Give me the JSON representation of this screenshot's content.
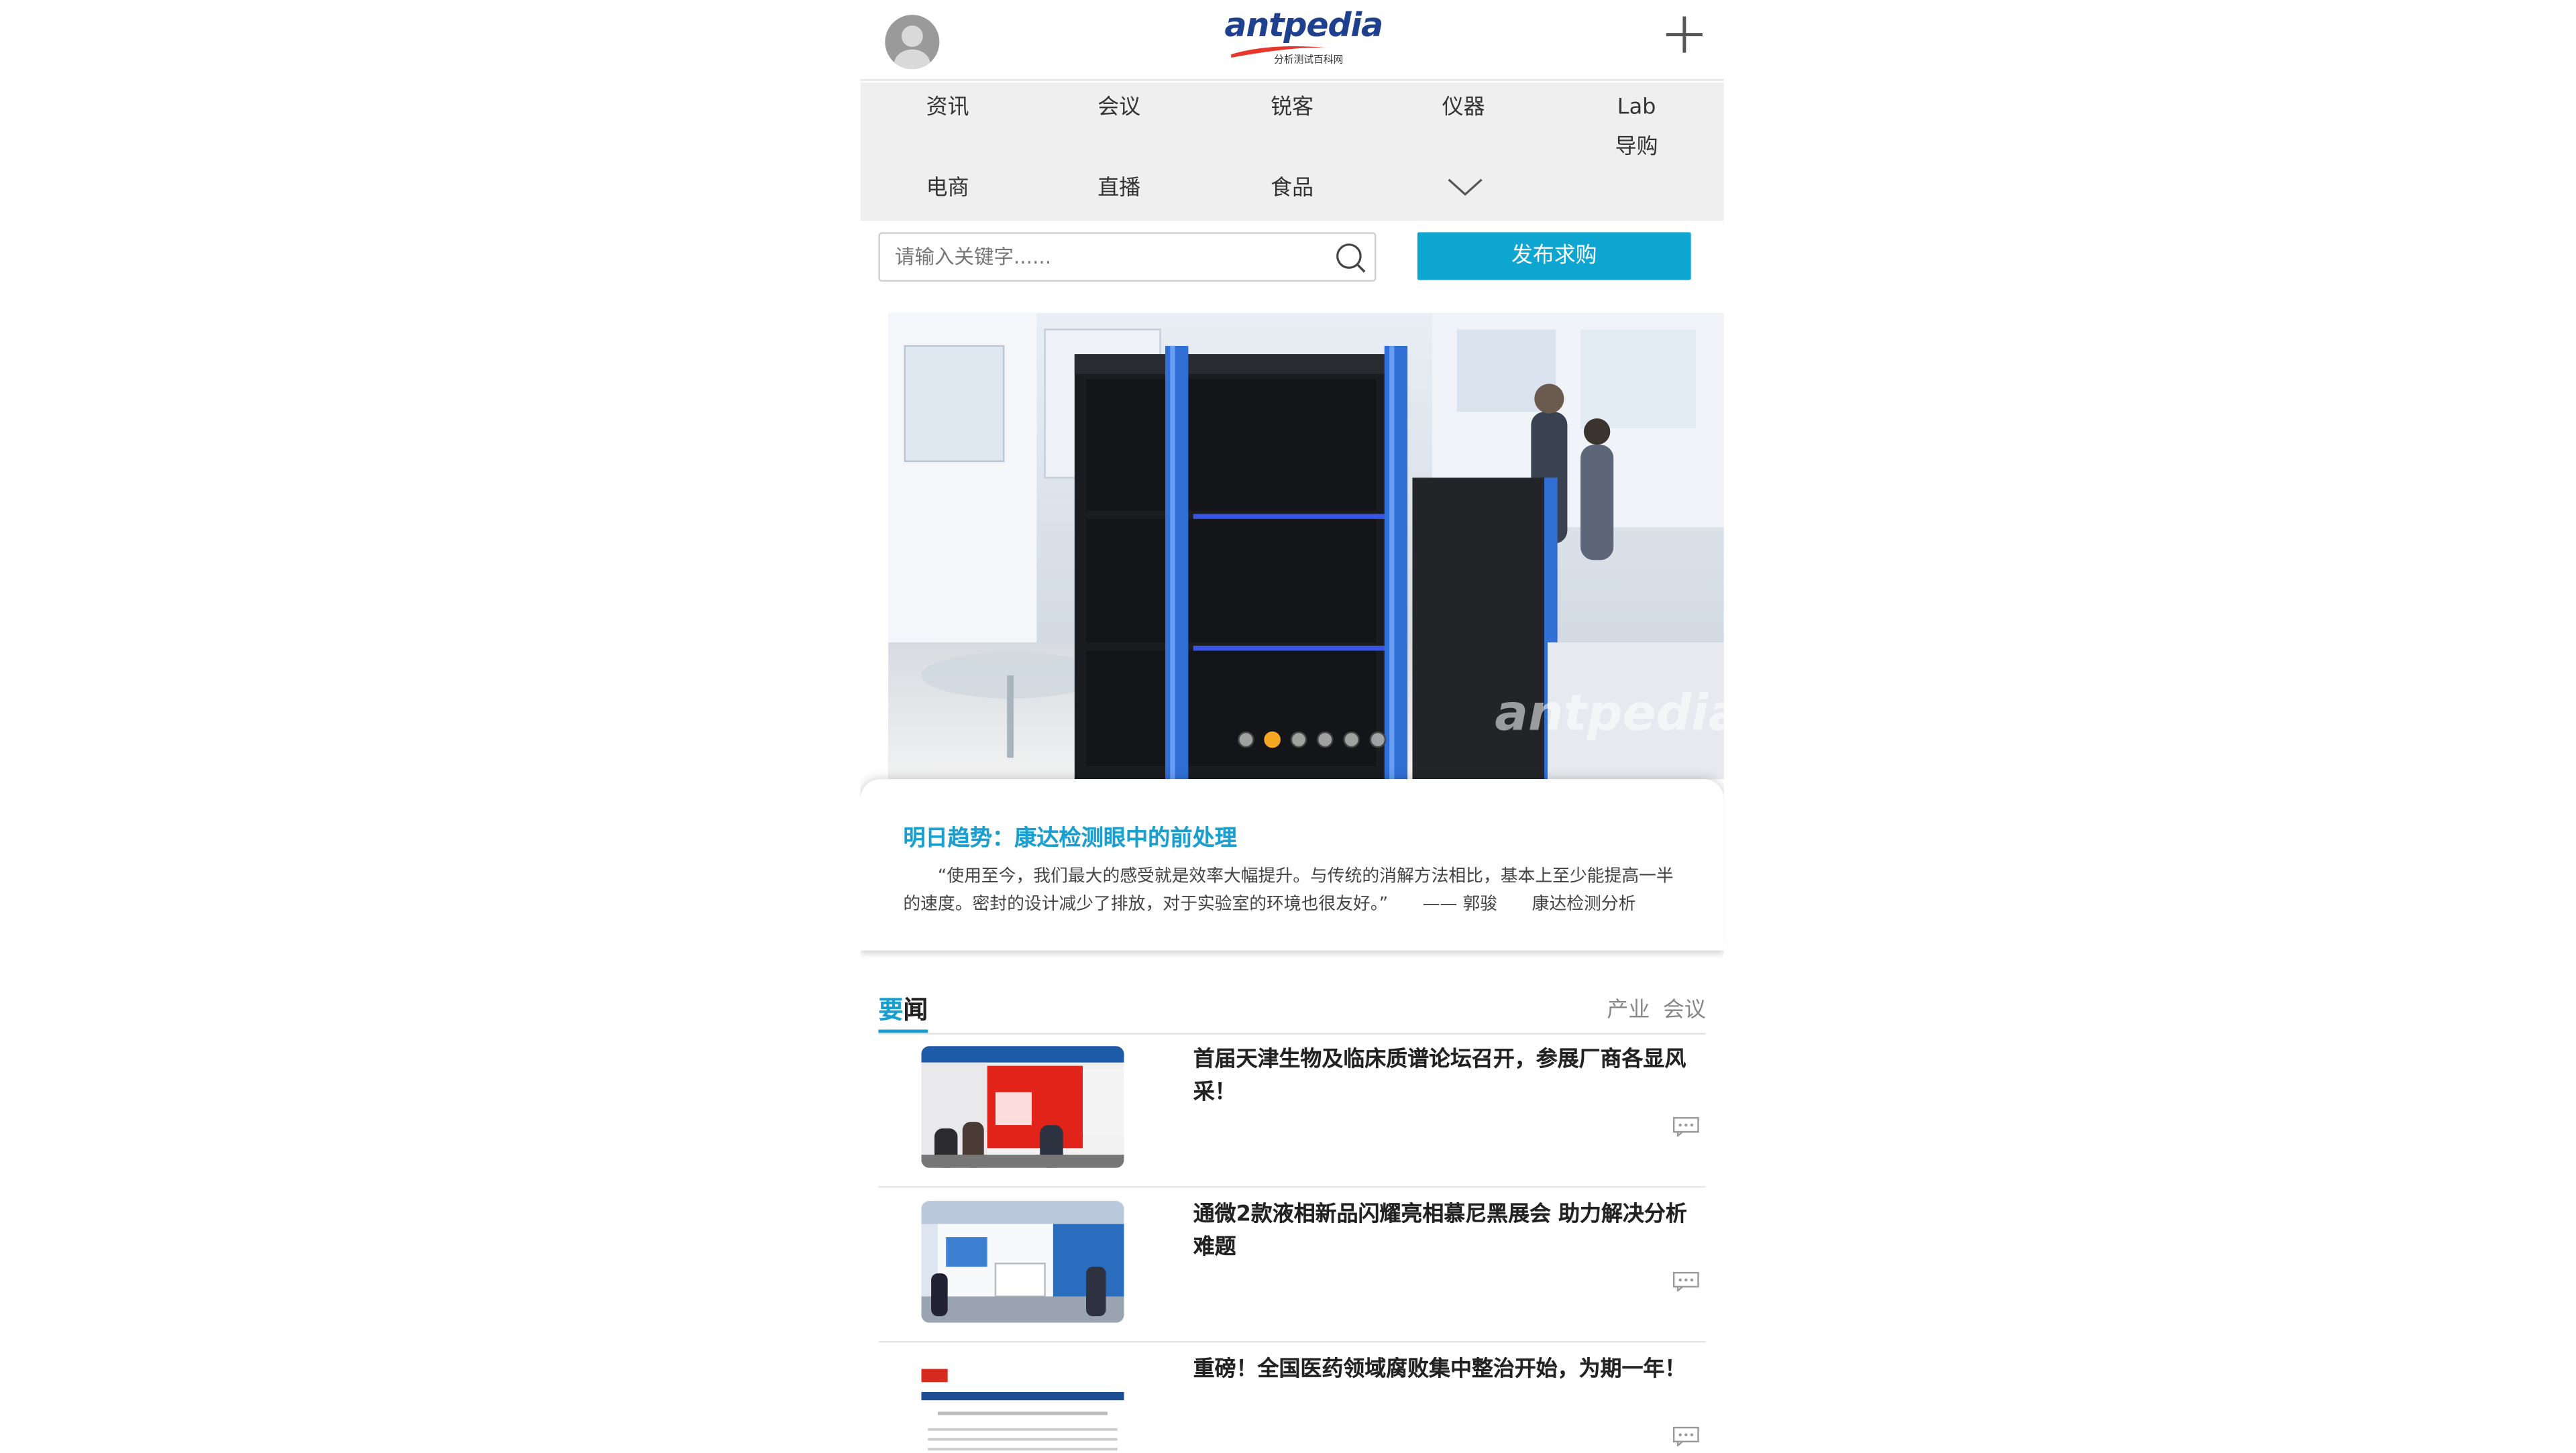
{
  "header": {
    "logo_text": "antpedia",
    "logo_subtitle": "分析测试百科网"
  },
  "nav": {
    "items": [
      {
        "label": "资讯"
      },
      {
        "label": "会议"
      },
      {
        "label": "锐客"
      },
      {
        "label": "仪器"
      },
      {
        "label": "Lab"
      },
      {
        "label": "导购"
      },
      {
        "label": "电商"
      },
      {
        "label": "直播"
      },
      {
        "label": "食品"
      }
    ]
  },
  "search": {
    "placeholder": "请输入关键字......"
  },
  "publish_button": "发布求购",
  "carousel": {
    "dot_count": 6,
    "active_dot": 2,
    "watermark": "antpedia"
  },
  "feature_card": {
    "title": "明日趋势：康达检测眼中的前处理",
    "text": "“使用至今，我们最大的感受就是效率大幅提升。与传统的消解方法相比，基本上至少能提高一半的速度。密封的设计减少了排放，对于实验室的环境也很友好。”　　—— 郭骏　　康达检测分析"
  },
  "news_tabs": {
    "active_prefix": "要",
    "active_rest": "闻",
    "others": [
      "产业",
      "会议"
    ]
  },
  "news": [
    {
      "title": "首届天津生物及临床质谱论坛召开，参展厂商各显风采！"
    },
    {
      "title": "通微2款液相新品闪耀亮相慕尼黑展会 助力解决分析难题"
    },
    {
      "title": "重磅！全国医药领域腐败集中整治开始，为期一年！"
    }
  ],
  "icons": {
    "avatar": "user-avatar-icon",
    "plus": "plus-icon",
    "chevron": "chevron-down-icon",
    "search": "search-icon",
    "comment": "comment-icon"
  },
  "colors": {
    "accent": "#0ea5d1",
    "title_blue": "#1a9fcf",
    "active_dot": "#f5a623",
    "nav_bg": "#efefef"
  }
}
